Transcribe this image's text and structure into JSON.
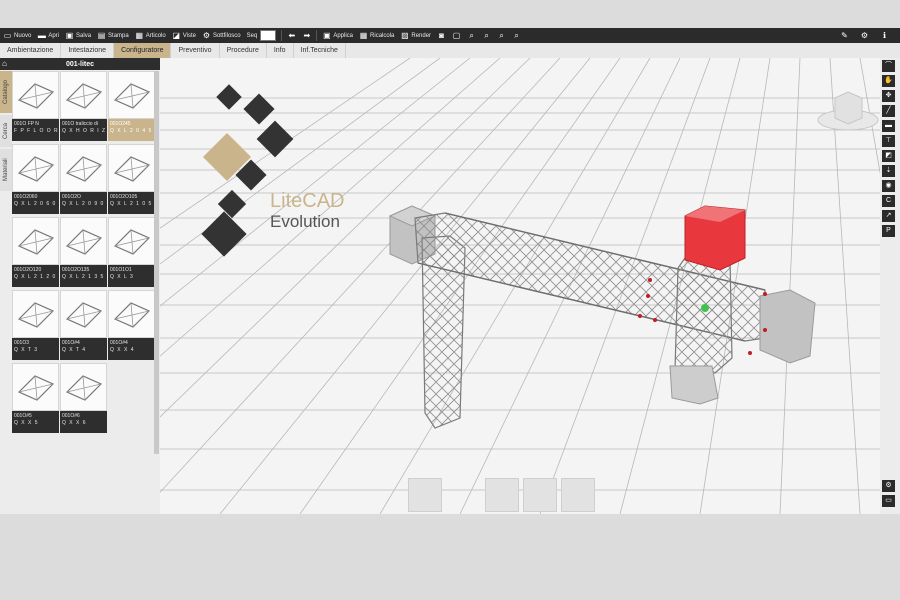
{
  "toolbar": {
    "buttons": [
      {
        "label": "Nuovo",
        "icon": "new-file-icon"
      },
      {
        "label": "Apri",
        "icon": "folder-icon"
      },
      {
        "label": "Salva",
        "icon": "save-icon"
      },
      {
        "label": "Stampa",
        "icon": "print-icon"
      },
      {
        "label": "Articolo",
        "icon": "article-icon"
      },
      {
        "label": "Viste",
        "icon": "views-icon"
      },
      {
        "label": "Sottfilosco",
        "icon": "sort-icon"
      },
      {
        "label": "Seq",
        "icon": "sequence-icon"
      }
    ],
    "right_buttons": [
      {
        "label": "Applica",
        "icon": "apply-icon"
      },
      {
        "label": "Ricalcola",
        "icon": "recalculate-icon"
      },
      {
        "label": "Render",
        "icon": "render-icon"
      }
    ]
  },
  "menu": {
    "tabs": [
      "Ambientazione",
      "Intestazione",
      "Configuratore",
      "Preventivo",
      "Procedure",
      "Info",
      "Inf.Tecniche"
    ],
    "active": "Configuratore"
  },
  "panel": {
    "title": "001-litec",
    "side_tabs": [
      "Catalogo",
      "Cerca",
      "Materiali"
    ],
    "items": [
      {
        "code": "001O FP N",
        "name": "F P   F L O O R"
      },
      {
        "code": "001O traliccio di",
        "name": "Q X   H O R I Z"
      },
      {
        "code": "001O245",
        "name": "Q X   L 2 0 4 5"
      },
      {
        "code": "001O2060",
        "name": "Q X   L 2 0 6 0"
      },
      {
        "code": "001O2O",
        "name": "Q X   L 2 0 9 0"
      },
      {
        "code": "001O2O105",
        "name": "Q X   L 2 1 0 5"
      },
      {
        "code": "001O2O120",
        "name": "Q X   L 2 1 2 0"
      },
      {
        "code": "001O2O135",
        "name": "Q X   L 2 1 3 5"
      },
      {
        "code": "001O1O1",
        "name": "Q X   L 3"
      },
      {
        "code": "001O3",
        "name": "Q X   T 3"
      },
      {
        "code": "001O#4",
        "name": "Q X   T 4"
      },
      {
        "code": "001O#4",
        "name": "Q X   X 4"
      },
      {
        "code": "001O#5",
        "name": "Q X   X 5"
      },
      {
        "code": "001O#6",
        "name": "Q X   X 6"
      }
    ],
    "selected_index": 2
  },
  "logo": {
    "line1": "LiteCAD",
    "line2": "Evolution"
  },
  "colors": {
    "accent": "#c9b48c",
    "dark": "#2b2b2b",
    "highlight_red": "#e8383d"
  }
}
